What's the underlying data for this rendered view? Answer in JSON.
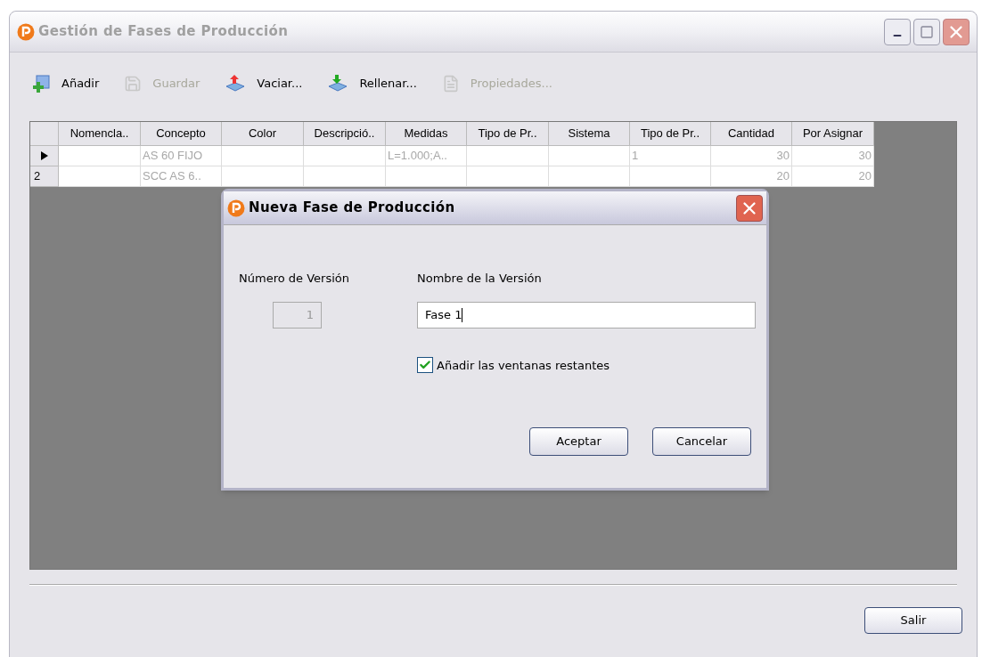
{
  "window": {
    "title": "Gestión de Fases de Producción"
  },
  "toolbar": [
    {
      "label": "Añadir",
      "kind": "add",
      "disabled": false
    },
    {
      "label": "Guardar",
      "kind": "save",
      "disabled": true
    },
    {
      "label": "Vaciar...",
      "kind": "empty",
      "disabled": false
    },
    {
      "label": "Rellenar...",
      "kind": "fill",
      "disabled": false
    },
    {
      "label": "Propiedades...",
      "kind": "properties",
      "disabled": true
    }
  ],
  "table": {
    "columns": [
      "Nomencla..",
      "Concepto",
      "Color",
      "Descripció..",
      "Medidas",
      "Tipo de Pr..",
      "Sistema",
      "Tipo de Pr..",
      "Cantidad",
      "Por Asignar"
    ],
    "rows": [
      {
        "current": true,
        "cells": [
          "",
          "AS 60 FIJO",
          "",
          "",
          "L=1.000;A..",
          "",
          "",
          "1",
          "30",
          "30"
        ]
      },
      {
        "current": false,
        "header": "2",
        "cells": [
          "",
          "SCC AS 6..",
          "",
          "",
          "",
          "",
          "",
          "",
          "20",
          "20"
        ]
      }
    ]
  },
  "dialog": {
    "title": "Nueva Fase de Producción",
    "number_label": "Número de Versión",
    "number_value": "1",
    "name_label": "Nombre de la Versión",
    "name_value": "Fase 1",
    "checkbox": {
      "label": "Añadir las ventanas restantes",
      "checked": true
    },
    "buttons": [
      "Aceptar",
      "Cancelar"
    ]
  },
  "exit_button": "Salir"
}
